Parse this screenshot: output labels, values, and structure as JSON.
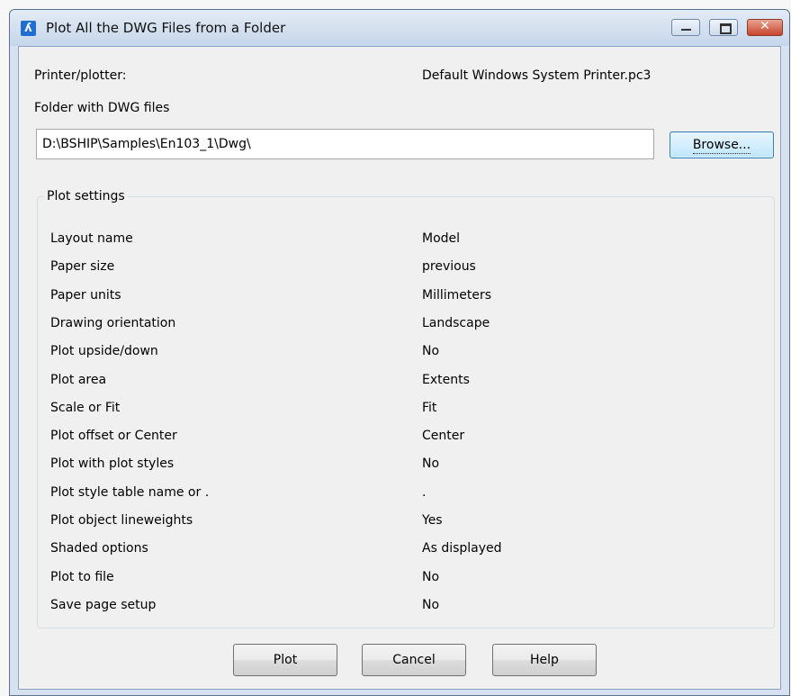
{
  "window": {
    "title": "Plot All the DWG Files from a Folder",
    "app_icon": "bricscad-icon",
    "controls": {
      "minimize": "minimize-icon",
      "maximize": "maximize-icon",
      "close_glyph": "✕"
    }
  },
  "printer": {
    "label": "Printer/plotter:",
    "value": "Default Windows System Printer.pc3"
  },
  "folder": {
    "label": "Folder with DWG files",
    "value": "D:\\BSHIP\\Samples\\En103_1\\Dwg\\",
    "browse_label": "Browse..."
  },
  "plot_settings": {
    "title": "Plot settings",
    "rows": [
      {
        "name": "Layout name",
        "value": "Model"
      },
      {
        "name": "Paper size",
        "value": "previous"
      },
      {
        "name": "Paper units",
        "value": "Millimeters"
      },
      {
        "name": "Drawing orientation",
        "value": "Landscape"
      },
      {
        "name": "Plot upside/down",
        "value": "No"
      },
      {
        "name": "Plot area",
        "value": "Extents"
      },
      {
        "name": "Scale or Fit",
        "value": "Fit"
      },
      {
        "name": "Plot offset or Center",
        "value": "Center"
      },
      {
        "name": "Plot with plot styles",
        "value": "No"
      },
      {
        "name": "Plot style table name or .",
        "value": "."
      },
      {
        "name": "Plot object lineweights",
        "value": "Yes"
      },
      {
        "name": "Shaded options",
        "value": "As displayed"
      },
      {
        "name": "Plot to file",
        "value": "No"
      },
      {
        "name": "Save page setup",
        "value": "No"
      }
    ]
  },
  "buttons": {
    "plot": "Plot",
    "cancel": "Cancel",
    "help": "Help"
  },
  "colors": {
    "titlebar": "#c6d6ea",
    "client": "#f0f0f0",
    "close_button": "#c8452c",
    "app_icon": "#1f6fd1"
  }
}
